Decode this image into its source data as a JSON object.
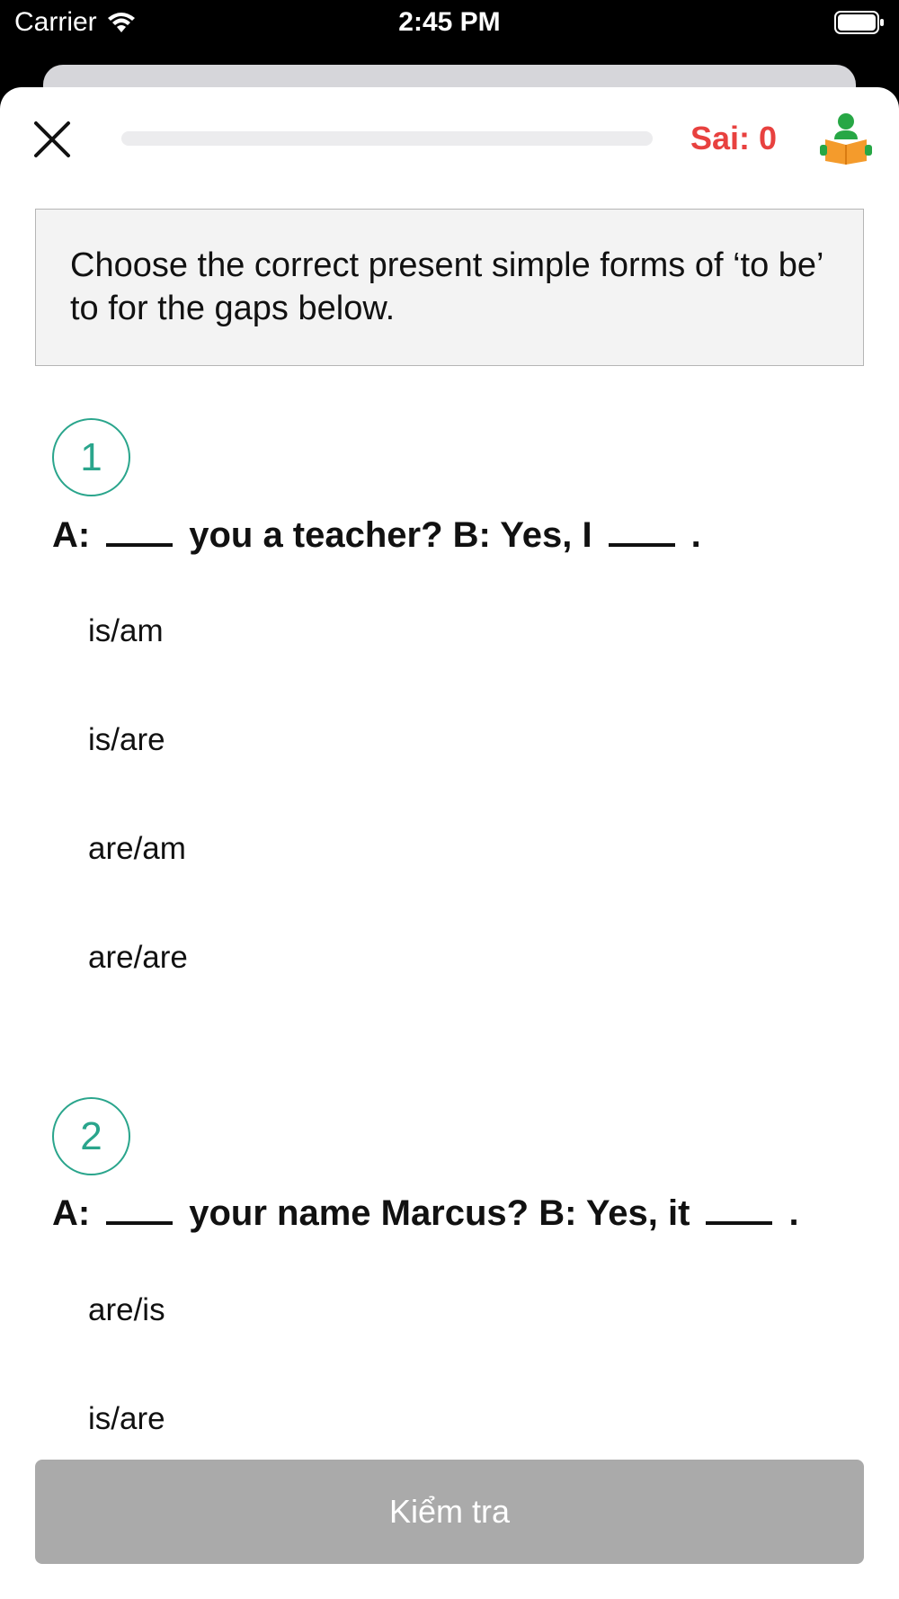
{
  "status_bar": {
    "carrier": "Carrier",
    "time": "2:45 PM",
    "icons": [
      "wifi-icon",
      "battery-icon"
    ]
  },
  "header": {
    "close_icon": "close-icon",
    "progress": 0,
    "wrong_label": "Sai: 0",
    "reader_icon": "reading-person-icon",
    "colors": {
      "wrong": "#e8413f",
      "accent": "#2aa58c"
    }
  },
  "instruction": "Choose the correct present simple forms of ‘to be’ to for the gaps below.",
  "questions": [
    {
      "number": "1",
      "parts": [
        "A:",
        "you a teacher? B: Yes, I",
        "."
      ],
      "options": [
        "is/am",
        "is/are",
        "are/am",
        "are/are"
      ]
    },
    {
      "number": "2",
      "parts": [
        "A:",
        "your name Marcus? B: Yes, it",
        "."
      ],
      "options": [
        "are/is",
        "is/are"
      ]
    }
  ],
  "footer": {
    "check_button": "Kiểm tra",
    "button_color": "#aaaaaa"
  }
}
